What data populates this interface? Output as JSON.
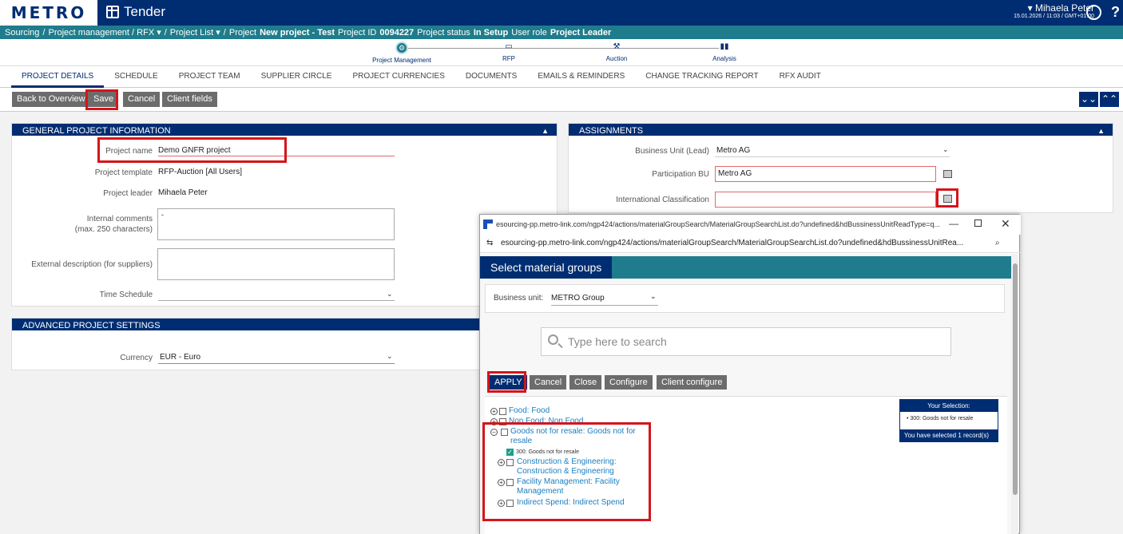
{
  "brand": {
    "logo": "METRO",
    "app_title": "Tender",
    "primary": "#002d72",
    "teal": "#1f7c8c",
    "highlight": "#d4151b"
  },
  "user": {
    "name": "Mihaela Peter",
    "datetime": "15.01.2026 / 11:03 / GMT+01:00",
    "help": "?"
  },
  "breadcrumb": {
    "sourcing": "Sourcing",
    "sep": "/",
    "project_mgmt": "Project management / RFX",
    "project_list": "Project List",
    "project_label": "Project",
    "project_name": "New project - Test",
    "project_id_label": "Project ID",
    "project_id": "0094227",
    "status_label": "Project status",
    "status": "In Setup",
    "role_label": "User role",
    "role": "Project Leader"
  },
  "stepper": [
    "Project Management",
    "RFP",
    "Auction",
    "Analysis"
  ],
  "tabs": [
    "PROJECT DETAILS",
    "SCHEDULE",
    "PROJECT TEAM",
    "SUPPLIER CIRCLE",
    "PROJECT CURRENCIES",
    "DOCUMENTS",
    "EMAILS & REMINDERS",
    "CHANGE TRACKING REPORT",
    "RFX AUDIT"
  ],
  "toolbar": {
    "back": "Back to Overview",
    "save": "Save",
    "cancel": "Cancel",
    "client_fields": "Client fields",
    "expand": "⌄⌄",
    "collapse": "⌃⌃"
  },
  "general": {
    "title": "GENERAL PROJECT INFORMATION",
    "name_label": "Project name",
    "name_value": "Demo GNFR project",
    "template_label": "Project template",
    "template_value": "RFP-Auction [All Users]",
    "leader_label": "Project leader",
    "leader_value": "Mihaela Peter",
    "internal_label": "Internal comments",
    "internal_sub": "(max. 250 characters)",
    "internal_value": "-",
    "external_label": "External description (for suppliers)",
    "schedule_label": "Time Schedule"
  },
  "advanced": {
    "title": "ADVANCED PROJECT SETTINGS",
    "currency_label": "Currency",
    "currency_value": "EUR - Euro"
  },
  "assignments": {
    "title": "ASSIGNMENTS",
    "bu_label": "Business Unit (Lead)",
    "bu_value": "Metro AG",
    "pbu_label": "Participation BU",
    "pbu_value": "Metro AG",
    "ic_label": "International Classification"
  },
  "popup": {
    "window_title": "esourcing-pp.metro-link.com/ngp424/actions/materialGroupSearch/MaterialGroupSearchList.do?undefined&hdBussinessUnitReadType=q...",
    "url": "esourcing-pp.metro-link.com/ngp424/actions/materialGroupSearch/MaterialGroupSearchList.do?undefined&hdBussinessUnitRea...",
    "heading": "Select material groups",
    "bu_label": "Business unit:",
    "bu_value": "METRO Group",
    "search_placeholder": "Type here to search",
    "apply": "APPLY",
    "cancel": "Cancel",
    "close": "Close",
    "configure": "Configure",
    "client_configure": "Client configure",
    "tree": {
      "food": "Food: Food",
      "nonfood": "Non Food: Non Food",
      "gnfr": "Goods not for resale: Goods not for resale",
      "gnfr_code": "300: Goods not for resale",
      "ce": "Construction & Engineering: Construction & Engineering",
      "fm": "Facility Management: Facility Management",
      "is": "Indirect Spend: Indirect Spend"
    },
    "selection": {
      "title": "Your Selection:",
      "item": "300: Goods not for resale",
      "footer": "You have selected 1 record(s)"
    }
  }
}
